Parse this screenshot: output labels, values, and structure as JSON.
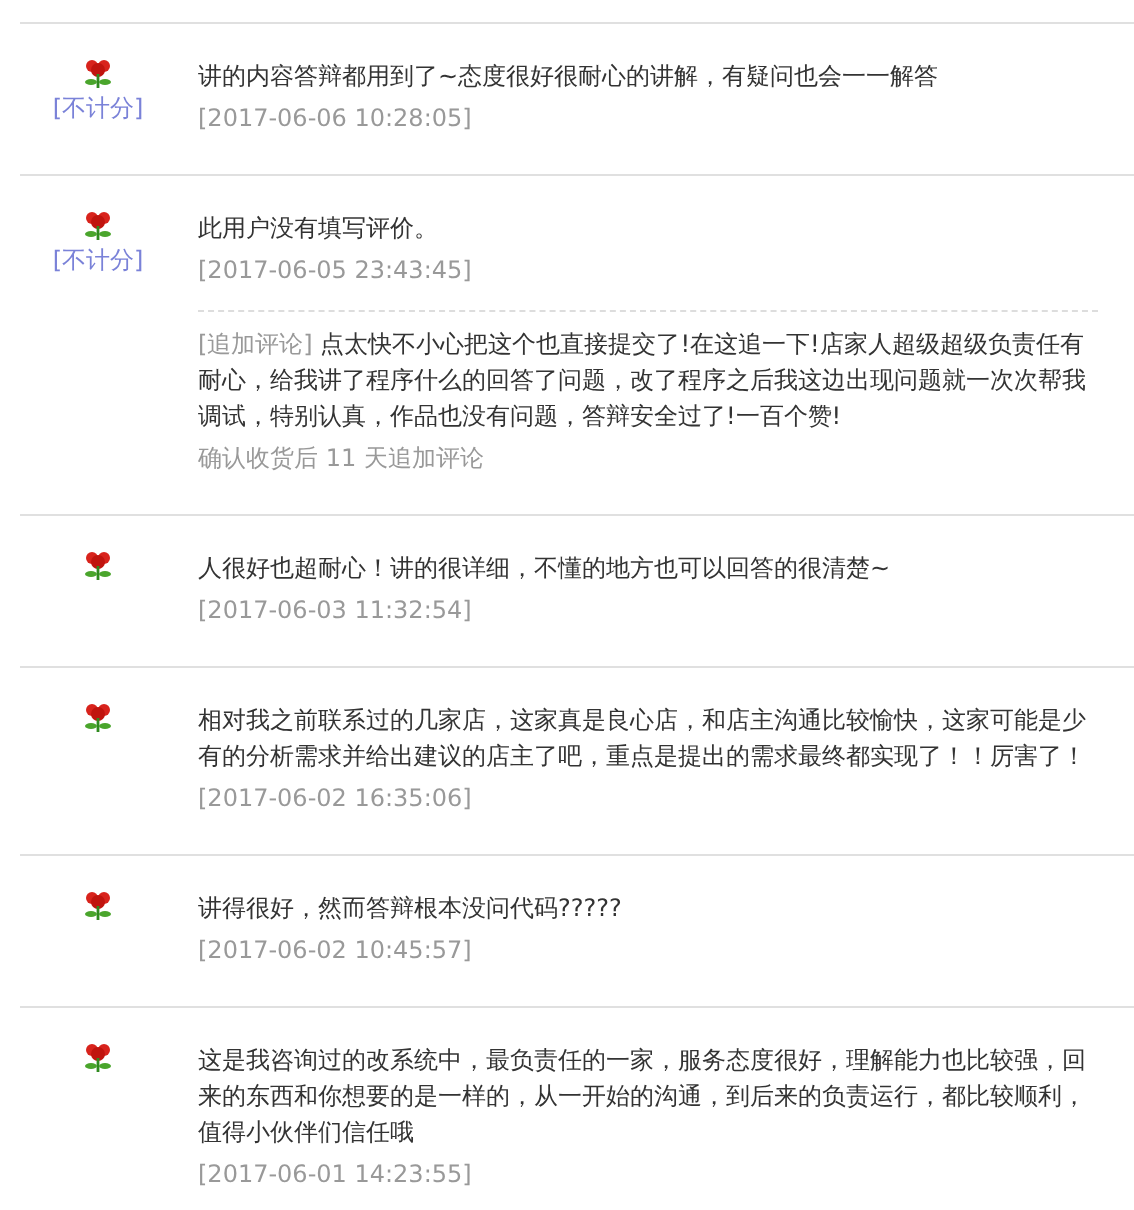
{
  "reviews": [
    {
      "score_note": "[不计分]",
      "text": "讲的内容答辩都用到了~态度很好很耐心的讲解，有疑问也会一一解答",
      "time": "[2017-06-06 10:28:05]"
    },
    {
      "score_note": "[不计分]",
      "text": "此用户没有填写评价。",
      "time": "[2017-06-05 23:43:45]",
      "append": {
        "label": "[追加评论]",
        "text": "点太快不小心把这个也直接提交了!在这追一下!店家人超级超级负责任有耐心，给我讲了程序什么的回答了问题，改了程序之后我这边出现问题就一次次帮我调试，特别认真，作品也没有问题，答辩安全过了!一百个赞!",
        "note": "确认收货后 11 天追加评论"
      }
    },
    {
      "text": "人很好也超耐心！讲的很详细，不懂的地方也可以回答的很清楚~",
      "time": "[2017-06-03 11:32:54]"
    },
    {
      "text": "相对我之前联系过的几家店，这家真是良心店，和店主沟通比较愉快，这家可能是少有的分析需求并给出建议的店主了吧，重点是提出的需求最终都实现了！！厉害了！",
      "time": "[2017-06-02 16:35:06]"
    },
    {
      "text": "讲得很好，然而答辩根本没问代码?????",
      "time": "[2017-06-02 10:45:57]"
    },
    {
      "text": "这是我咨询过的改系统中，最负责任的一家，服务态度很好，理解能力也比较强，回来的东西和你想要的是一样的，从一开始的沟通，到后来的负责运行，都比较顺利，值得小伙伴们信任哦",
      "time": "[2017-06-01 14:23:55]"
    }
  ]
}
